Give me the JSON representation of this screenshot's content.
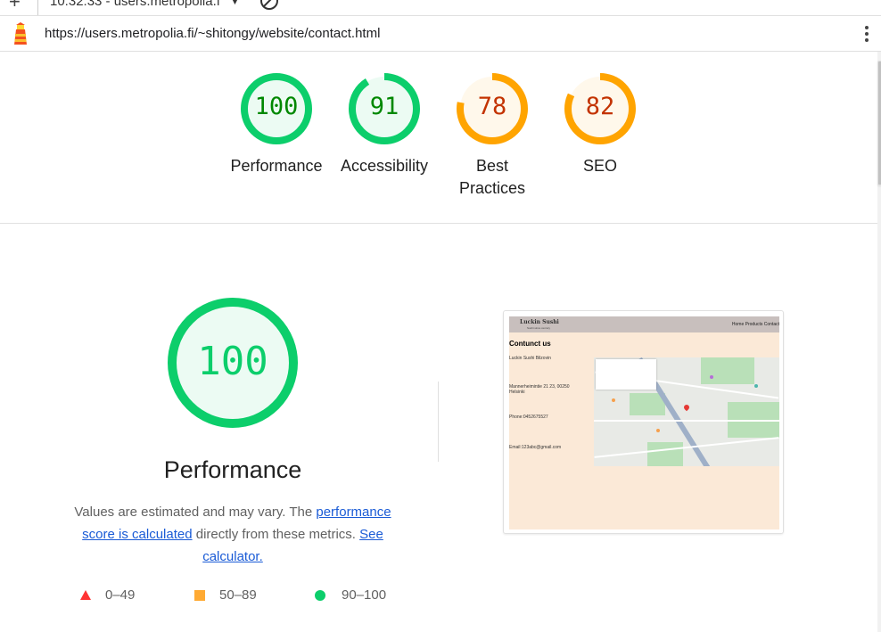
{
  "browser": {
    "tab_title": "10:32:33 - users.metropolia.f",
    "url": "https://users.metropolia.fi/~shitongy/website/contact.html"
  },
  "colors": {
    "pass": "#0cce6b",
    "pass_text": "#008800",
    "average": "#ffa400",
    "average_text": "#c33300",
    "fail": "#ff3333",
    "link": "#1a5bd6"
  },
  "scores": [
    {
      "label": "Performance",
      "value": "100",
      "rating": "pass"
    },
    {
      "label": "Accessibility",
      "value": "91",
      "rating": "pass"
    },
    {
      "label": "Best Practices",
      "value": "78",
      "rating": "average"
    },
    {
      "label": "SEO",
      "value": "82",
      "rating": "average"
    }
  ],
  "performance": {
    "score": "100",
    "title": "Performance",
    "desc_prefix": "Values are estimated and may vary. The ",
    "desc_link1": "performance score is calculated",
    "desc_middle": " directly from these metrics. ",
    "desc_link2": "See calculator."
  },
  "legend": [
    {
      "range": "0–49",
      "icon": "triangle-icon"
    },
    {
      "range": "50–89",
      "icon": "square-icon"
    },
    {
      "range": "90–100",
      "icon": "circle-icon"
    }
  ],
  "screenshot": {
    "brand": "Luckin Sushi",
    "brand_sub": "Sushi since century",
    "nav": "Home  Products  Contact",
    "heading": "Contunct us",
    "name": "Luckin Sushi Bilzovin",
    "address": "Mannerheimintie 21 23, 00250 Helsinki",
    "phone": "Phone:0452675527",
    "email": "Email:123abc@gmail.com"
  }
}
